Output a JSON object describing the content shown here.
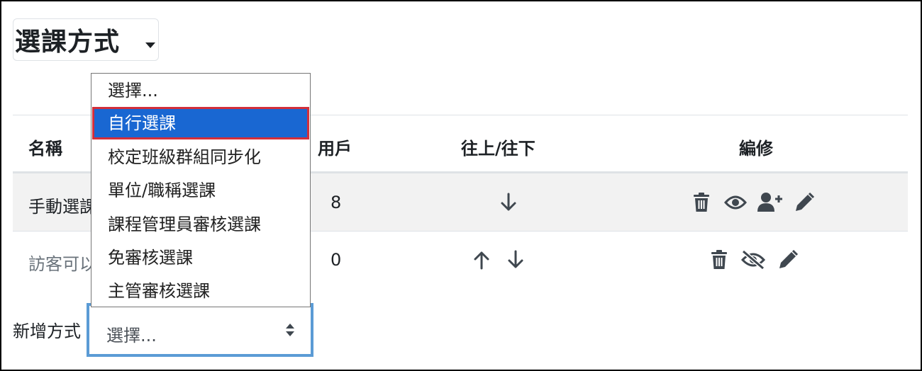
{
  "header": {
    "title": "選課方式"
  },
  "table": {
    "columns": {
      "name": "名稱",
      "users": "用戶",
      "updown": "往上/往下",
      "edit": "編修"
    },
    "rows": [
      {
        "name": "手動選課",
        "users": "8"
      },
      {
        "name": "訪客可以",
        "users": "0"
      }
    ]
  },
  "add_method": {
    "label": "新增方式",
    "select_value": "選擇...",
    "options": [
      "選擇...",
      "自行選課",
      "校定班級群組同步化",
      "單位/職稱選課",
      "課程管理員審核選課",
      "免審核選課",
      "主管審核選課"
    ],
    "highlighted_option": "自行選課"
  },
  "colors": {
    "highlight": "#1967d2",
    "highlight_border": "#d32f3a",
    "focus_border": "#5b9bd5",
    "icon": "#3f474f"
  },
  "icons": [
    "caret-down-icon",
    "trash-icon",
    "eye-icon",
    "eye-slash-icon",
    "user-plus-icon",
    "pencil-icon",
    "arrow-up-icon",
    "arrow-down-icon",
    "sort-arrows-icon"
  ]
}
